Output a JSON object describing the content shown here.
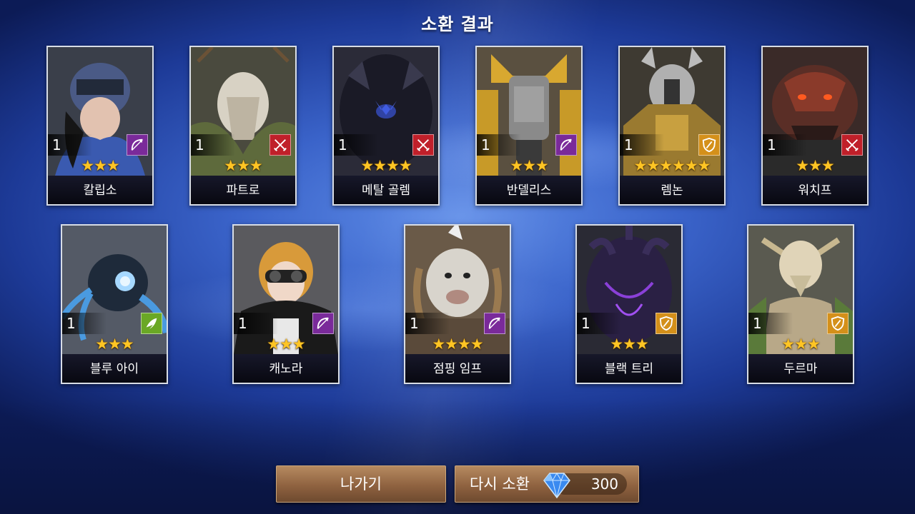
{
  "title": "소환 결과",
  "cards": [
    {
      "name": "칼립소",
      "level": "1",
      "stars": "★★★",
      "class": "archer"
    },
    {
      "name": "파트로",
      "level": "1",
      "stars": "★★★",
      "class": "warrior"
    },
    {
      "name": "메탈 골렘",
      "level": "1",
      "stars": "★★★★",
      "class": "warrior"
    },
    {
      "name": "반델리스",
      "level": "1",
      "stars": "★★★",
      "class": "archer"
    },
    {
      "name": "렘논",
      "level": "1",
      "stars": "★★★★★★",
      "class": "tank"
    },
    {
      "name": "워치프",
      "level": "1",
      "stars": "★★★",
      "class": "warrior"
    },
    {
      "name": "블루 아이",
      "level": "1",
      "stars": "★★★",
      "class": "support"
    },
    {
      "name": "캐노라",
      "level": "1",
      "stars": "★★★",
      "class": "archer"
    },
    {
      "name": "점핑 임프",
      "level": "1",
      "stars": "★★★★",
      "class": "archer"
    },
    {
      "name": "블랙 트리",
      "level": "1",
      "stars": "★★★",
      "class": "tank"
    },
    {
      "name": "두르마",
      "level": "1",
      "stars": "★★★",
      "class": "tank"
    }
  ],
  "buttons": {
    "exit_label": "나가기",
    "again_label": "다시 소환",
    "cost": "300"
  },
  "colors": {
    "archer": "#7a2a9a",
    "warrior": "#c0202a",
    "tank": "#d4901a",
    "support": "#6aa825",
    "star": "#ffc524"
  }
}
